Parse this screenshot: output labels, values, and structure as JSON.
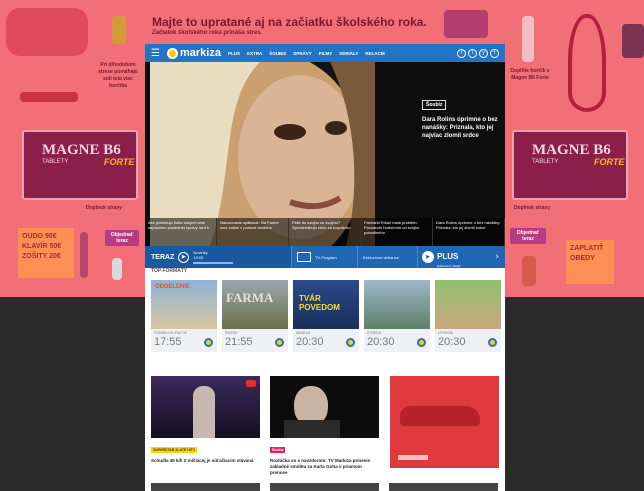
{
  "ad": {
    "headline": "Majte to upratané aj na začiatku školského roka.",
    "subline": "Začiatok školského roka prináša stres.",
    "left_copy": "Pri dlhodobom strese pomáhajú soli tela viac horčíka",
    "right_copy": "Doplňte horčík s Magne B6 Forte",
    "brand": "MAGNE B6",
    "variant": "FORTE",
    "form": "TABLETY",
    "cta": "Objednať teraz",
    "note_left": "OUDO 90€ KLAVÍR 50€ ZOŠITY 20€",
    "note_right": "ZAPLATIŤ OBEDY",
    "small_left": "Doplnok stravy",
    "small_right": "Doplnok stravy"
  },
  "nav": {
    "menu_icon": "hamburger-icon",
    "logo": "markiza",
    "items": [
      "PLUS",
      "EXTRA",
      "ŠOUBIZ",
      "SPRÁVY",
      "FILMY",
      "SERIÁLY",
      "RELACIE"
    ],
    "social": [
      "f",
      "i",
      "y",
      "t"
    ]
  },
  "hero": {
    "badge": "Šoubiz",
    "title": "Dara Rolins úprimne o bez nanášky: Priznala, kto jej najviac zlomil srdce",
    "strip": [
      "Ako potrebujú ľudia záujem sme zapísaním poslednej správy na trh",
      "Nalosovanie aplikácie: Na Farme sme zatkol v pomoci tamtoho",
      "Fidle do svojho zo svojmu? Sprostredkujú cenu za rozprávku",
      "Farmárki Ríšaž mala problém: Pozváncik hudobním od svojho pohodlného",
      "Dara Rolins úprimne o bez nanášky: Priznala, kto jej zlomil srdce"
    ]
  },
  "live": {
    "now_label": "TERAZ",
    "now_show": "Novinky",
    "now_time": "19:00",
    "tv_label": "TV Program",
    "video_label": "Exkluzívne videá na",
    "plus_label": "PLUS",
    "plus_sub": "Exkluzívny obsah"
  },
  "top": {
    "title": "TOP FORMÁTY",
    "cards": [
      {
        "day": "PONDELOK-PIATOK",
        "time": "17:55"
      },
      {
        "day": "PIATOK",
        "time": "21:55"
      },
      {
        "day": "NEDEĽA",
        "time": "20:30"
      },
      {
        "day": "STREDA",
        "time": "20:30"
      },
      {
        "day": "UTOROK",
        "time": "20:30"
      }
    ]
  },
  "thumb_titles": {
    "c1": "ODDELENIE",
    "c2": "FARMA",
    "c3": "TVÁR POVEDOM"
  },
  "news": [
    {
      "tag": "SUPERSTAR ZLATÉ HITY",
      "title": "Schudla 49 kíl! Z mlčiacej je súťažiacim stávaná"
    },
    {
      "tag": "Šoubiz",
      "title": "Rozlúčka so s navzdorom: TV Markíza prinesie zakladné smútku za Karla Gotta v priamom prenose"
    }
  ],
  "colors": {
    "brand_blue": "#2474c4",
    "ad_pink": "#f26f78",
    "accent_yellow": "#ffcc00"
  }
}
